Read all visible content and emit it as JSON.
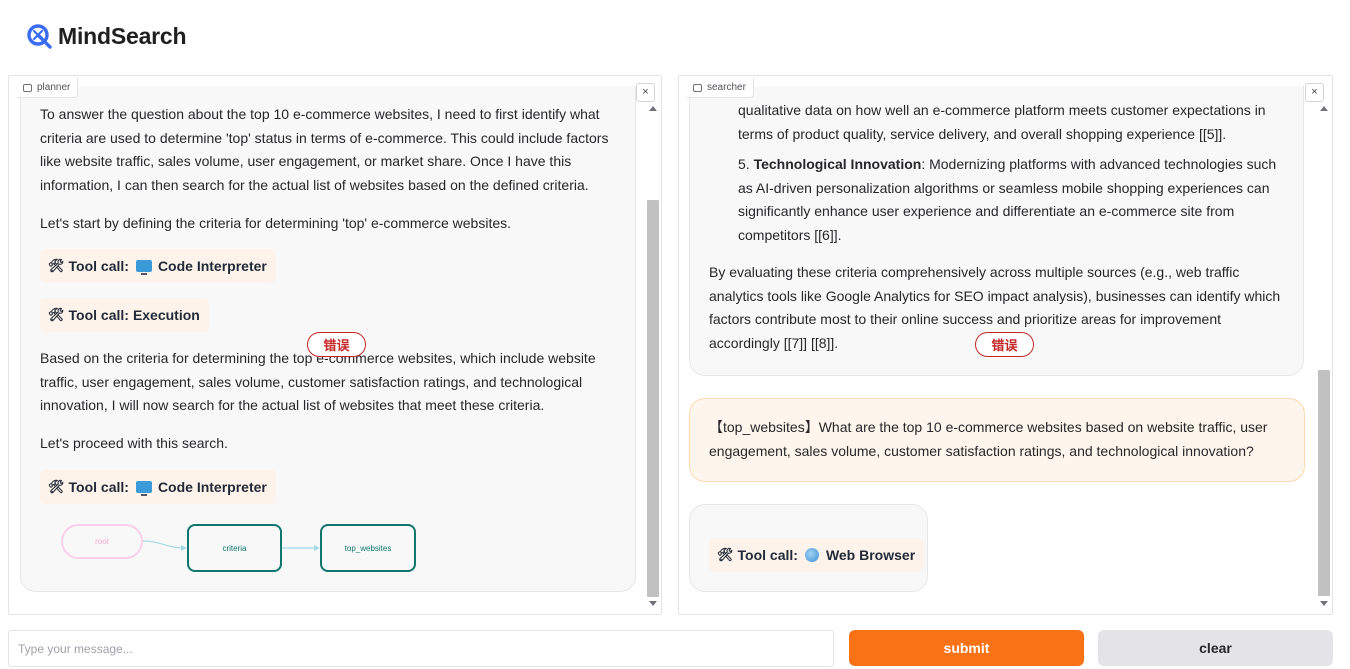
{
  "app": {
    "title": "MindSearch",
    "brand_color": "#3b6cf6"
  },
  "planner": {
    "label": "planner",
    "close": "×",
    "paragraphs": [
      "To answer the question about the top 10 e-commerce websites, I need to first identify what criteria are used to determine 'top' status in terms of e-commerce. This could include factors like website traffic, sales volume, user engagement, or market share. Once I have this information, I can then search for the actual list of websites based on the defined criteria.",
      "Let's start by defining the criteria for determining 'top' e-commerce websites.",
      "Based on the criteria for determining the top e-commerce websites, which include website traffic, user engagement, sales volume, customer satisfaction ratings, and technological innovation, I will now search for the actual list of websites that meet these criteria.",
      "Let's proceed with this search."
    ],
    "tool_calls": [
      {
        "prefix": "Tool call:",
        "tool": "Code Interpreter",
        "icon": "monitor-icon"
      },
      {
        "prefix": "Tool call:",
        "tool": "Execution",
        "icon": ""
      },
      {
        "prefix": "Tool call:",
        "tool": "Code Interpreter",
        "icon": "monitor-icon"
      }
    ],
    "graph": {
      "nodes": [
        "root",
        "criteria",
        "top_websites"
      ]
    },
    "error_badge": "错误"
  },
  "searcher": {
    "label": "searcher",
    "close": "×",
    "item4_cont": "qualitative data on how well an e-commerce platform meets customer expectations in terms of product quality, service delivery, and overall shopping experience [[5]].",
    "item5": {
      "number": "5.",
      "title": "Technological Innovation",
      "text": ": Modernizing platforms with advanced technologies such as AI-driven personalization algorithms or seamless mobile shopping experiences can significantly enhance user experience and differentiate an e-commerce site from competitors [[6]]."
    },
    "conclusion": "By evaluating these criteria comprehensively across multiple sources (e.g., web traffic analytics tools like Google Analytics for SEO impact analysis), businesses can identify which factors contribute most to their online success and prioritize areas for improvement accordingly [[7]] [[8]].",
    "query": "【top_websites】What are the top 10 e-commerce websites based on website traffic, user engagement, sales volume, customer satisfaction ratings, and technological innovation?",
    "tool_call": {
      "prefix": "Tool call:",
      "tool": "Web Browser",
      "icon": "globe-icon"
    },
    "error_badge": "错误"
  },
  "footer": {
    "placeholder": "Type your message...",
    "submit": "submit",
    "clear": "clear",
    "submit_color": "#f97316"
  }
}
